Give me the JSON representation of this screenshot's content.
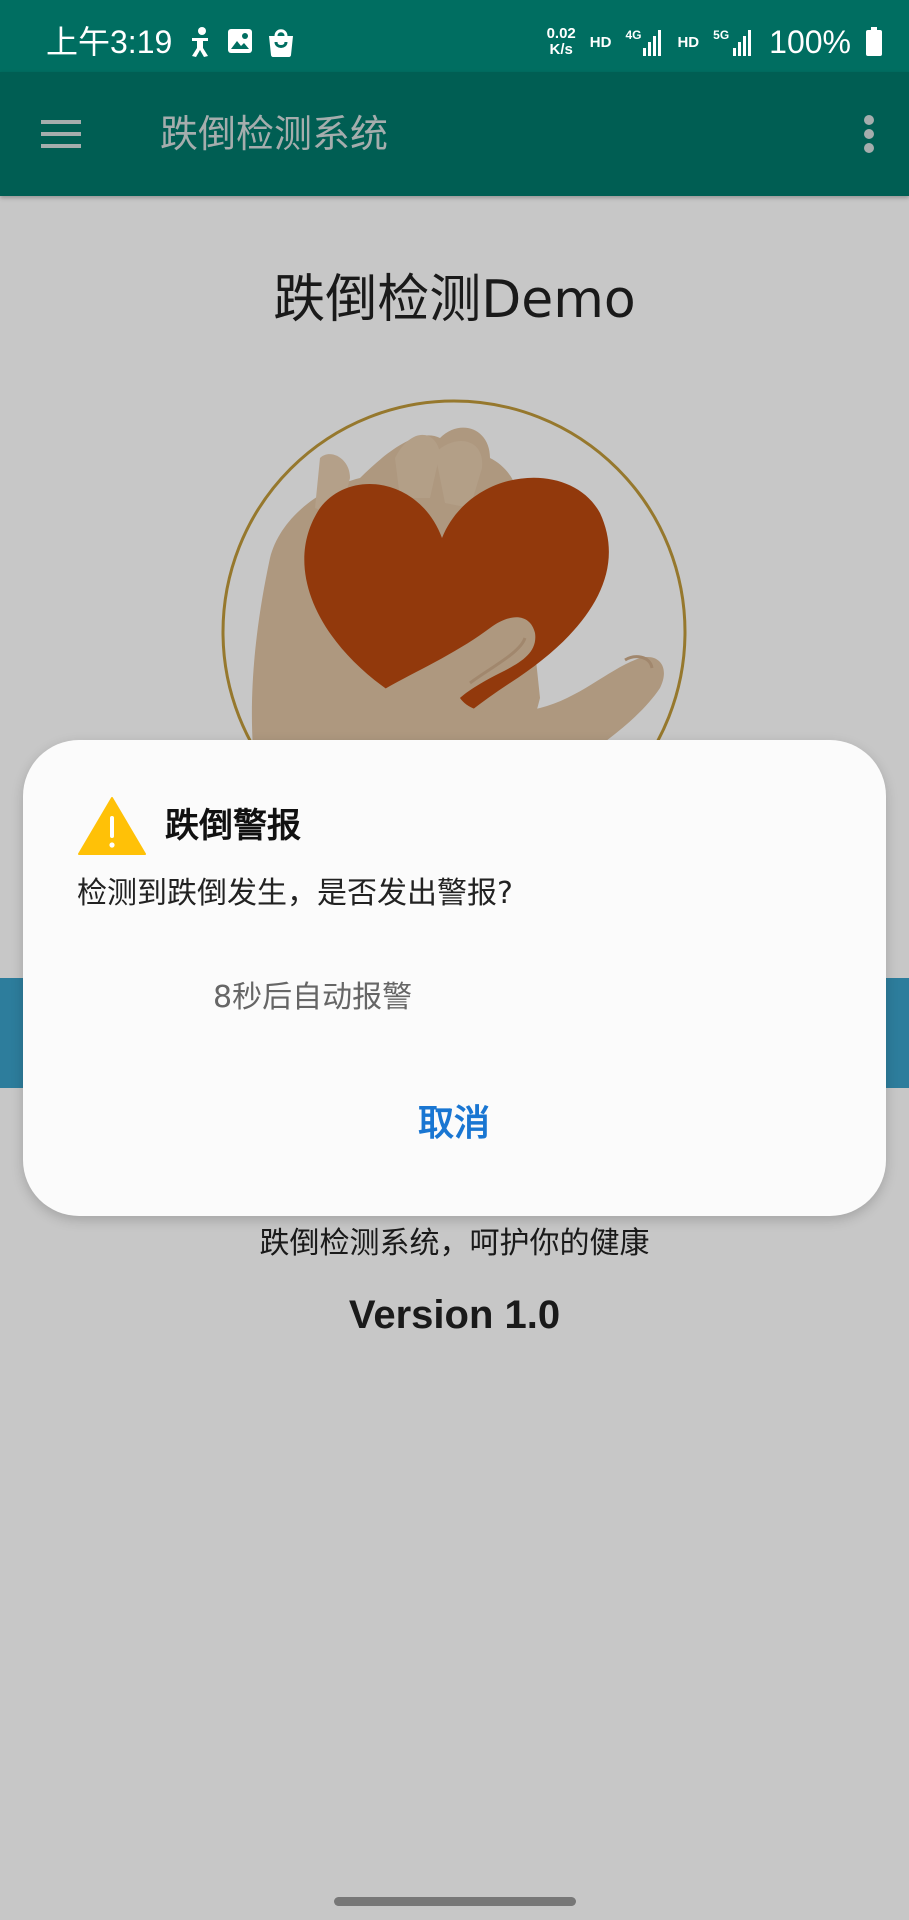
{
  "status_bar": {
    "time": "上午3:19",
    "net_speed_value": "0.02",
    "net_speed_unit": "K/s",
    "hd1": "HD",
    "net1": "4G",
    "hd2": "HD",
    "net2": "5G",
    "battery": "100%",
    "icons": [
      "accessibility-icon",
      "image-icon",
      "shopping-bag-icon",
      "signal-icon",
      "battery-icon"
    ]
  },
  "app_bar": {
    "title": "跌倒检测系统",
    "icons": [
      "hamburger-menu-icon",
      "more-vertical-icon"
    ]
  },
  "main": {
    "title": "跌倒检测Demo",
    "slogan": "跌倒检测系统，呵护你的健康",
    "version": "Version 1.0"
  },
  "dialog": {
    "title": "跌倒警报",
    "message": "检测到跌倒发生，是否发出警报?",
    "countdown": "8秒后自动报警",
    "cancel_label": "取消",
    "icon": "warning-icon"
  },
  "colors": {
    "status_bar": "#006e61",
    "app_bar": "#00796b",
    "accent_blue": "#3aa1c8",
    "button_text": "#1976d2",
    "heart": "#bb4a10",
    "warning": "#ffc107"
  }
}
